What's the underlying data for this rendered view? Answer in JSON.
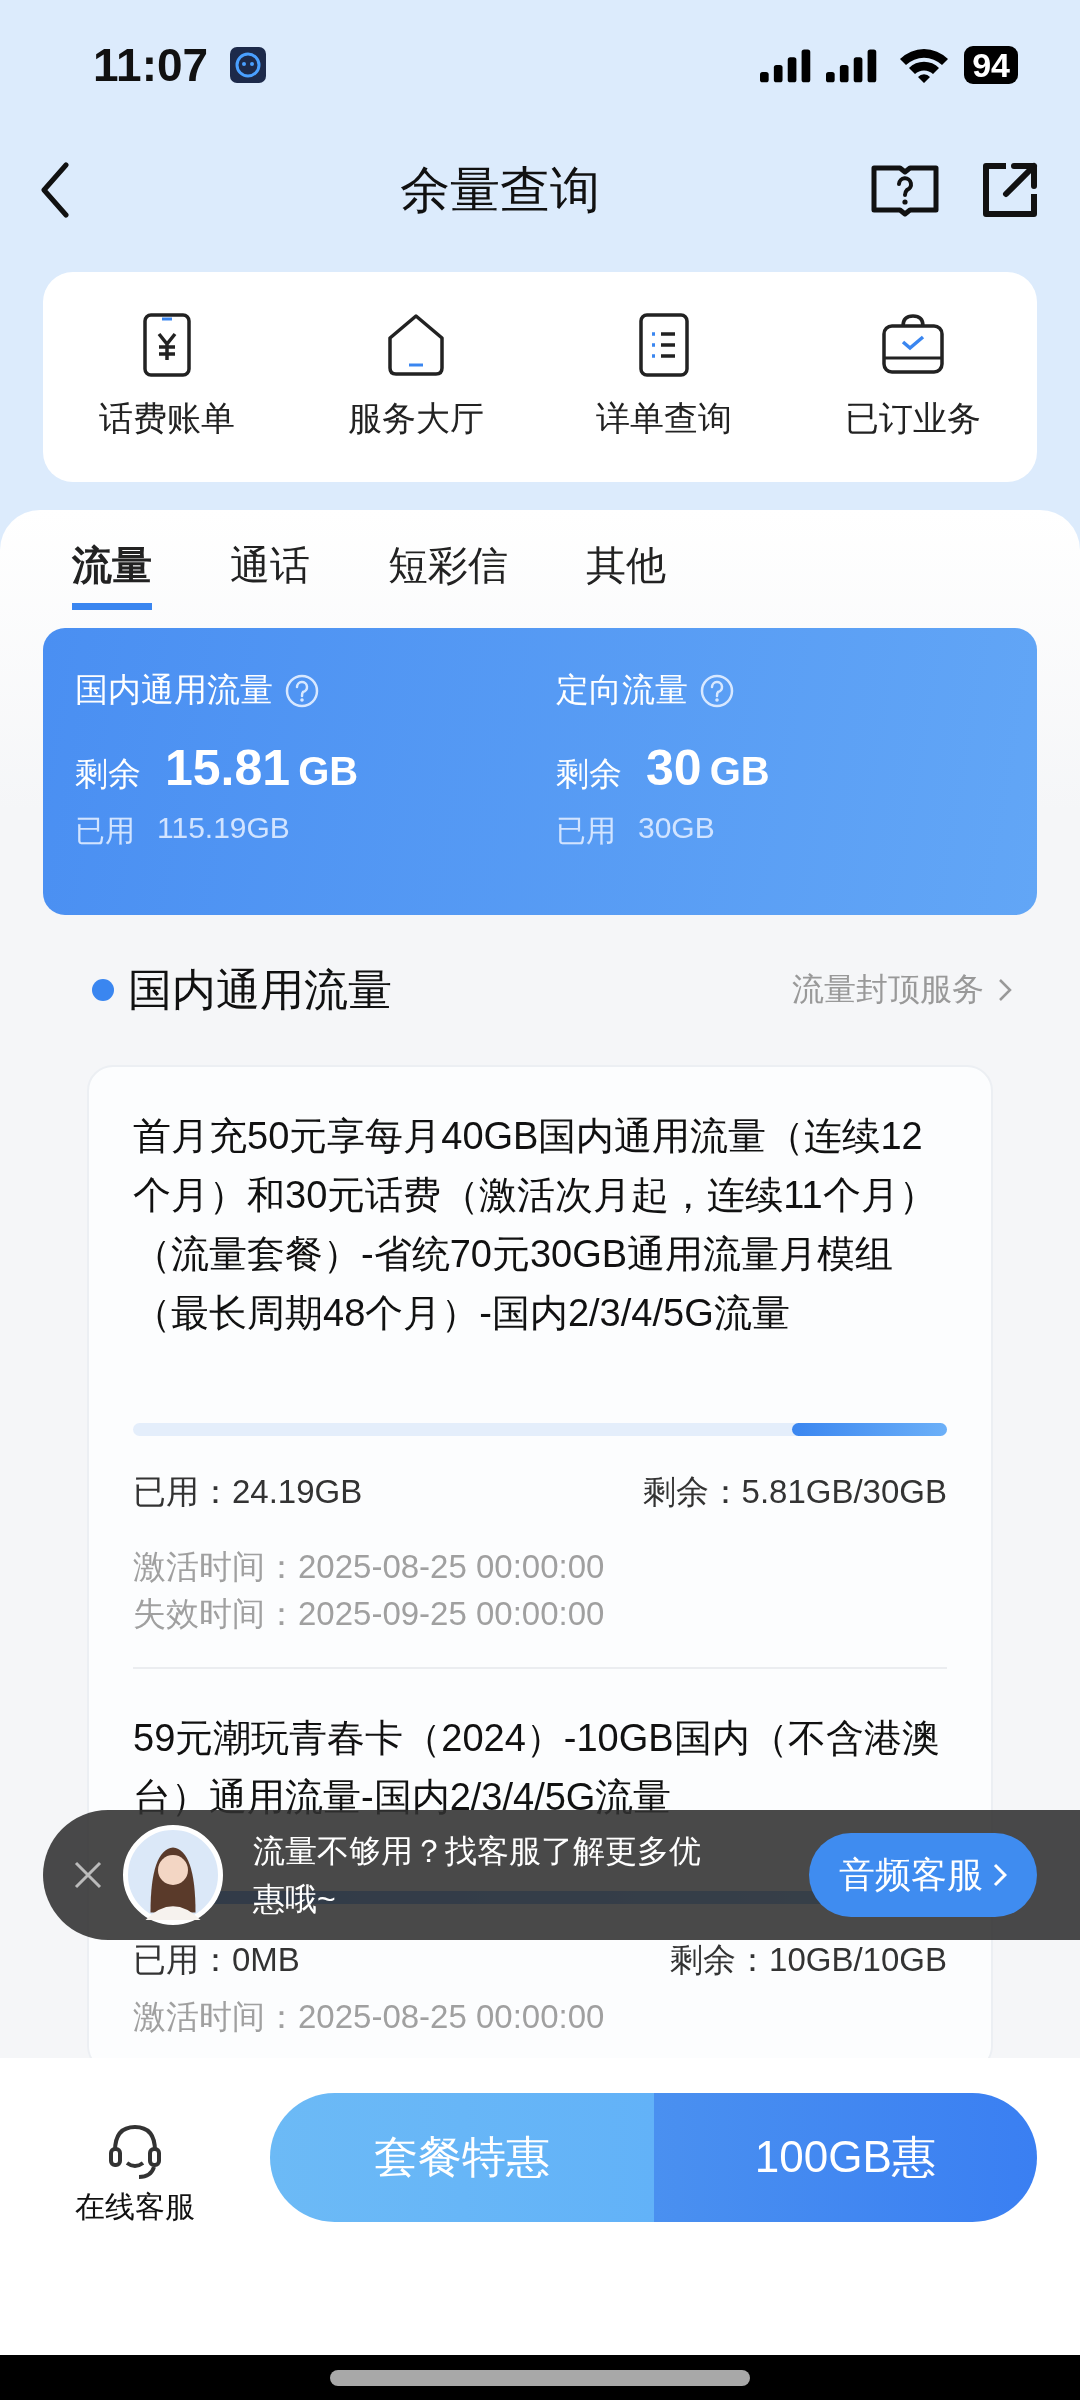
{
  "status_bar": {
    "time": "11:07",
    "battery": "94"
  },
  "nav": {
    "title": "余量查询"
  },
  "shortcuts": [
    {
      "label": "话费账单",
      "kind": "bill"
    },
    {
      "label": "服务大厅",
      "kind": "home"
    },
    {
      "label": "详单查询",
      "kind": "list"
    },
    {
      "label": "已订业务",
      "kind": "bag"
    }
  ],
  "tabs": [
    {
      "label": "流量",
      "selected": true
    },
    {
      "label": "通话",
      "selected": false
    },
    {
      "label": "短彩信",
      "selected": false
    },
    {
      "label": "其他",
      "selected": false
    }
  ],
  "summary": [
    {
      "title": "国内通用流量",
      "remaining_label": "剩余",
      "remaining_value": "15.81",
      "remaining_unit": "GB",
      "used_label": "已用",
      "used_value": "115.19GB"
    },
    {
      "title": "定向流量",
      "remaining_label": "剩余",
      "remaining_value": "30",
      "remaining_unit": "GB",
      "used_label": "已用",
      "used_value": "30GB"
    }
  ],
  "section": {
    "title": "国内通用流量",
    "link": "流量封顶服务"
  },
  "packages": [
    {
      "name": "首月充50元享每月40GB国内通用流量（连续12个月）和30元话费（激活次月起，连续11个月）（流量套餐）-省统70元30GB通用流量月模组（最长周期48个月）-国内2/3/4/5G流量",
      "level": 0.19,
      "used": "已用：24.19GB",
      "remaining": "剩余：5.81GB/30GB",
      "times": [
        "激活时间：2025-08-25 00:00:00",
        "失效时间：2025-09-25 00:00:00"
      ]
    },
    {
      "name": "59元潮玩青春卡（2024）-10GB国内（不含港澳台）通用流量-国内2/3/4/5G流量",
      "level": 1,
      "used": "已用：0MB",
      "remaining": "剩余：10GB/10GB",
      "times": [
        "激活时间：2025-08-25 00:00:00"
      ]
    }
  ],
  "promo_banner": {
    "message": "流量不够用？找客服了解更多优惠哦~",
    "button": "音频客服"
  },
  "bottom_bar": {
    "service_label": "在线客服",
    "buttons": [
      {
        "label": "套餐特惠",
        "kind": "light"
      },
      {
        "label": "100GB惠",
        "kind": "dark"
      }
    ]
  }
}
